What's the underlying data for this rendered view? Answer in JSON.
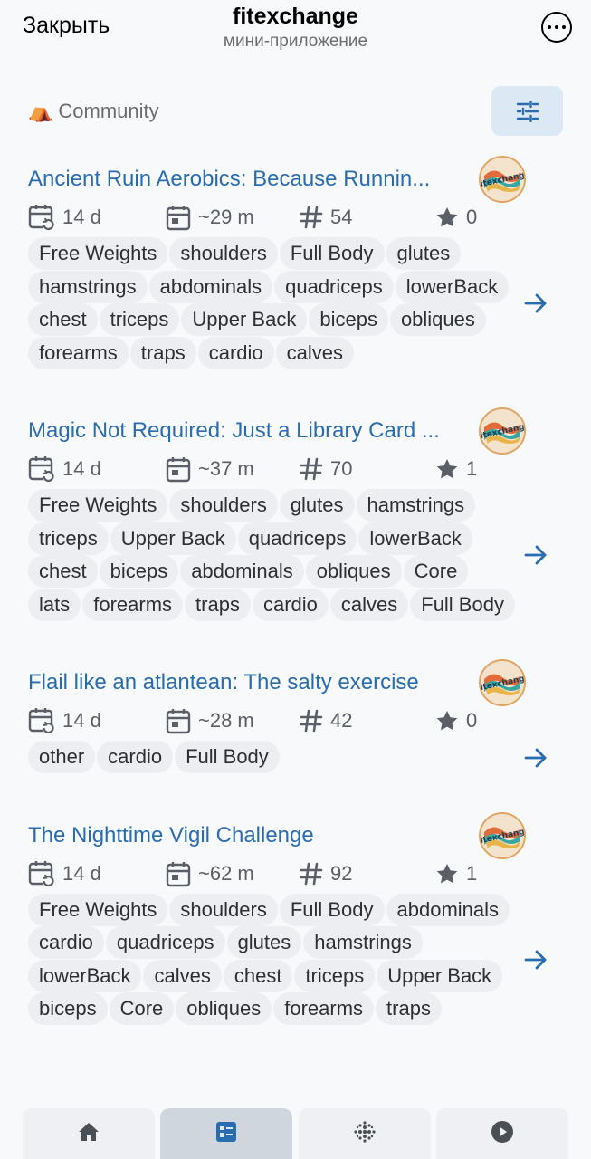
{
  "header": {
    "close_label": "Закрыть",
    "title": "fitexchange",
    "subtitle": "мини-приложение"
  },
  "section": {
    "label": "Community",
    "icon": "tent-icon"
  },
  "workouts": [
    {
      "title": "Ancient Ruin Aerobics: Because Runnin...",
      "age": "14 d",
      "duration": "~29 m",
      "exercises": "54",
      "stars": "0",
      "tags": [
        "Free Weights",
        "shoulders",
        "Full Body",
        "glutes",
        "hamstrings",
        "abdominals",
        "quadriceps",
        "lowerBack",
        "chest",
        "triceps",
        "Upper Back",
        "biceps",
        "obliques",
        "forearms",
        "traps",
        "cardio",
        "calves"
      ]
    },
    {
      "title": "Magic Not Required: Just a Library Card ...",
      "age": "14 d",
      "duration": "~37 m",
      "exercises": "70",
      "stars": "1",
      "tags": [
        "Free Weights",
        "shoulders",
        "glutes",
        "hamstrings",
        "triceps",
        "Upper Back",
        "quadriceps",
        "lowerBack",
        "chest",
        "biceps",
        "abdominals",
        "obliques",
        "Core",
        "lats",
        "forearms",
        "traps",
        "cardio",
        "calves",
        "Full Body"
      ]
    },
    {
      "title": "Flail like an atlantean: The salty exercise",
      "age": "14 d",
      "duration": "~28 m",
      "exercises": "42",
      "stars": "0",
      "tags": [
        "other",
        "cardio",
        "Full Body"
      ]
    },
    {
      "title": "The Nighttime Vigil Challenge",
      "age": "14 d",
      "duration": "~62 m",
      "exercises": "92",
      "stars": "1",
      "tags": [
        "Free Weights",
        "shoulders",
        "Full Body",
        "abdominals",
        "cardio",
        "quadriceps",
        "glutes",
        "hamstrings",
        "lowerBack",
        "calves",
        "chest",
        "triceps",
        "Upper Back",
        "biceps",
        "Core",
        "obliques",
        "forearms",
        "traps"
      ]
    }
  ],
  "bottom_nav": [
    {
      "icon": "home-icon",
      "active": false
    },
    {
      "icon": "dashboard-icon",
      "active": true
    },
    {
      "icon": "dots-grid-icon",
      "active": false
    },
    {
      "icon": "play-circle-icon",
      "active": false
    }
  ],
  "colors": {
    "accent": "#2a6cb0",
    "background": "#f8f9fb",
    "tag_bg": "#eceef1",
    "active_nav": "#cfd6de"
  }
}
